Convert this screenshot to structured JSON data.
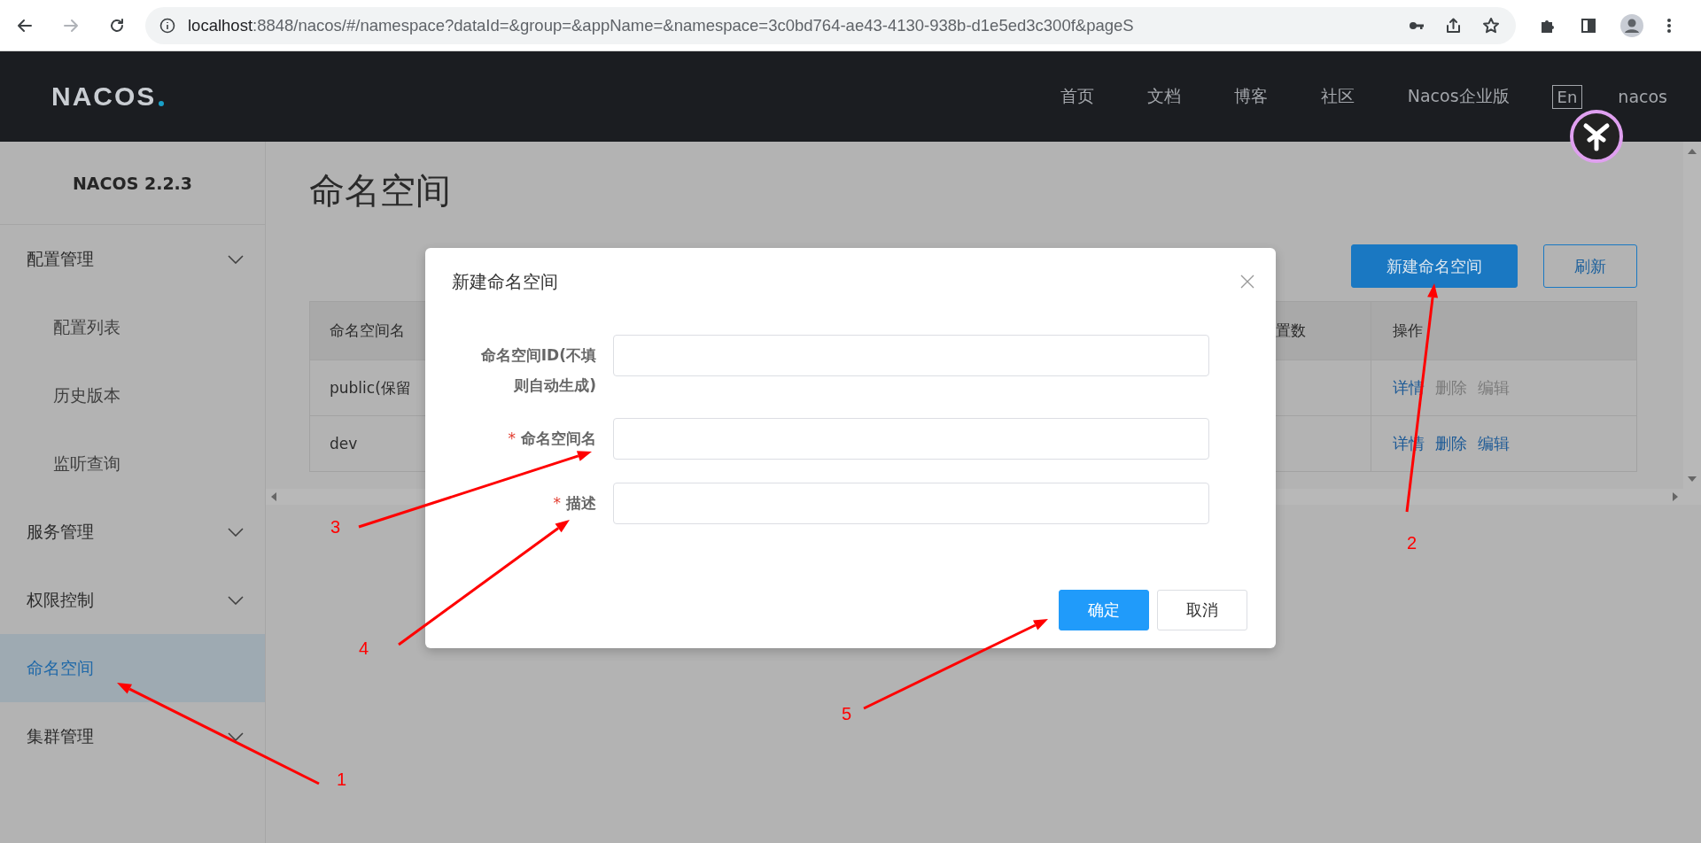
{
  "browser": {
    "url_host": "localhost",
    "url_rest": ":8848/nacos/#/namespace?dataId=&group=&appName=&namespace=3c0bd764-ae43-4130-938b-d1e5ed3c300f&pageS"
  },
  "header": {
    "logo": "NACOS",
    "nav": [
      "首页",
      "文档",
      "博客",
      "社区",
      "Nacos企业版"
    ],
    "language": "En",
    "user": "nacos"
  },
  "sidebar": {
    "title": "NACOS 2.2.3",
    "items": [
      {
        "label": "配置管理",
        "kind": "group",
        "selected": false,
        "children": [
          {
            "label": "配置列表",
            "selected": false
          },
          {
            "label": "历史版本",
            "selected": false
          },
          {
            "label": "监听查询",
            "selected": false
          }
        ]
      },
      {
        "label": "服务管理",
        "kind": "group",
        "selected": false
      },
      {
        "label": "权限控制",
        "kind": "group",
        "selected": false
      },
      {
        "label": "命名空间",
        "kind": "link",
        "selected": true
      },
      {
        "label": "集群管理",
        "kind": "group",
        "selected": false
      }
    ]
  },
  "page": {
    "title": "命名空间",
    "buttons": [
      {
        "label": "新建命名空间",
        "kind": "primary"
      },
      {
        "label": "刷新",
        "kind": "outline"
      }
    ]
  },
  "table": {
    "columns": [
      "命名空间名",
      "置数",
      "操作"
    ],
    "rows": [
      {
        "name": "public(保留",
        "actions": [
          {
            "label": "详情",
            "disabled": false
          },
          {
            "label": "删除",
            "disabled": true
          },
          {
            "label": "编辑",
            "disabled": true
          }
        ]
      },
      {
        "name": "dev",
        "actions": [
          {
            "label": "详情",
            "disabled": false
          },
          {
            "label": "删除",
            "disabled": false
          },
          {
            "label": "编辑",
            "disabled": false
          }
        ]
      }
    ]
  },
  "dialog": {
    "title": "新建命名空间",
    "fields": [
      {
        "label": "命名空间ID(不填则自动生成)"
      },
      {
        "label": "命名空间名",
        "required_mark": "*"
      },
      {
        "label": "描述",
        "required_mark": "*"
      }
    ],
    "buttons": [
      {
        "label": "确定",
        "kind": "primary"
      },
      {
        "label": "取消",
        "kind": "default"
      }
    ]
  },
  "annotations": [
    {
      "label": "1"
    },
    {
      "label": "2"
    },
    {
      "label": "3"
    },
    {
      "label": "4"
    },
    {
      "label": "5"
    }
  ]
}
